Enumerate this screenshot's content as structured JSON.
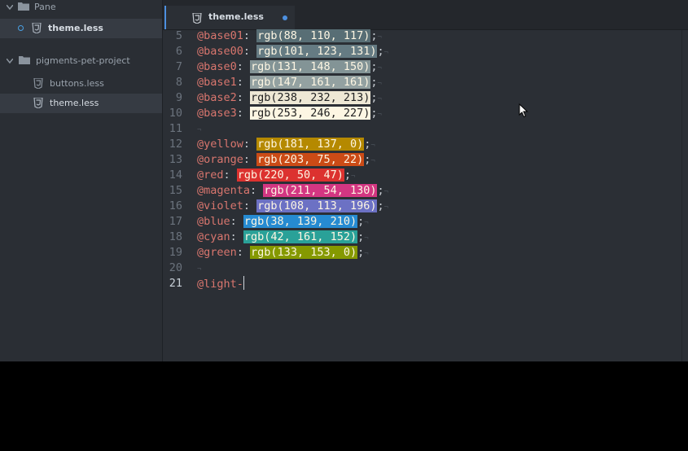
{
  "sidebar": {
    "pane_folder": "Pane",
    "pane_file": "theme.less",
    "project_folder": "pigments-pet-project",
    "files": [
      "buttons.less",
      "theme.less"
    ]
  },
  "tab": {
    "title": "theme.less"
  },
  "editor": {
    "lines": [
      {
        "num": "5",
        "var": "@base01",
        "rgb": "rgb(88, 110, 117)",
        "color": "#586e75",
        "fg": "#fdf6e3"
      },
      {
        "num": "6",
        "var": "@base00",
        "rgb": "rgb(101, 123, 131)",
        "color": "#657b83",
        "fg": "#fdf6e3"
      },
      {
        "num": "7",
        "var": "@base0",
        "rgb": "rgb(131, 148, 150)",
        "color": "#839496",
        "fg": "#fdf6e3"
      },
      {
        "num": "8",
        "var": "@base1",
        "rgb": "rgb(147, 161, 161)",
        "color": "#93a1a1",
        "fg": "#fdf6e3"
      },
      {
        "num": "9",
        "var": "@base2",
        "rgb": "rgb(238, 232, 213)",
        "color": "#eee8d5",
        "fg": "#222222"
      },
      {
        "num": "10",
        "var": "@base3",
        "rgb": "rgb(253, 246, 227)",
        "color": "#fdf6e3",
        "fg": "#222222"
      },
      {
        "num": "11"
      },
      {
        "num": "12",
        "var": "@yellow",
        "rgb": "rgb(181, 137, 0)",
        "color": "#b58900",
        "fg": "#fdf6e3"
      },
      {
        "num": "13",
        "var": "@orange",
        "rgb": "rgb(203, 75, 22)",
        "color": "#cb4b16",
        "fg": "#fdf6e3"
      },
      {
        "num": "14",
        "var": "@red",
        "rgb": "rgb(220, 50, 47)",
        "color": "#dc322f",
        "fg": "#fdf6e3"
      },
      {
        "num": "15",
        "var": "@magenta",
        "rgb": "rgb(211, 54, 130)",
        "color": "#d33682",
        "fg": "#fdf6e3"
      },
      {
        "num": "16",
        "var": "@violet",
        "rgb": "rgb(108, 113, 196)",
        "color": "#6c71c4",
        "fg": "#fdf6e3"
      },
      {
        "num": "17",
        "var": "@blue",
        "rgb": "rgb(38, 139, 210)",
        "color": "#268bd2",
        "fg": "#fdf6e3"
      },
      {
        "num": "18",
        "var": "@cyan",
        "rgb": "rgb(42, 161, 152)",
        "color": "#2aa198",
        "fg": "#fdf6e3"
      },
      {
        "num": "19",
        "var": "@green",
        "rgb": "rgb(133, 153, 0)",
        "color": "#859900",
        "fg": "#fdf6e3"
      },
      {
        "num": "20"
      },
      {
        "num": "21",
        "partial": "@light-",
        "current": true
      }
    ]
  }
}
